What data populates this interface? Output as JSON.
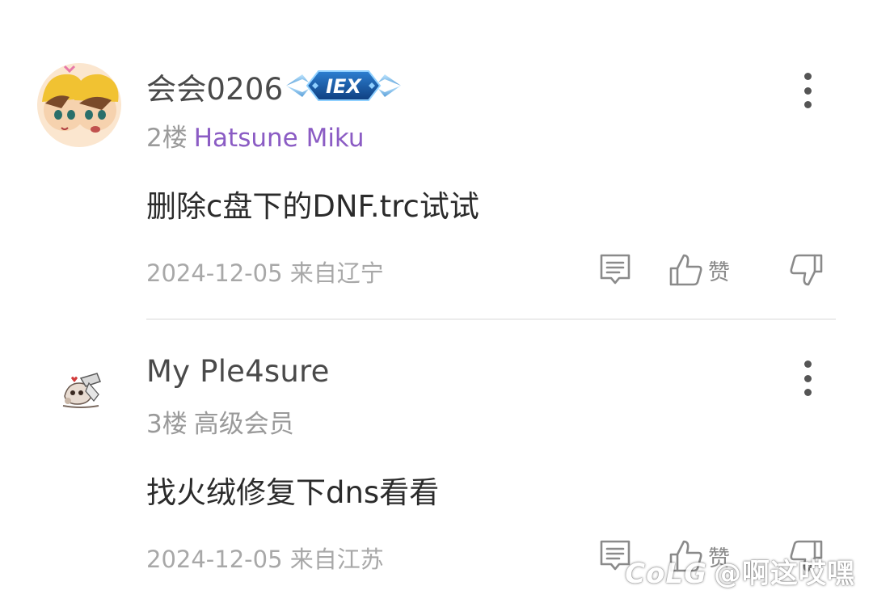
{
  "comments": [
    {
      "username": "会会0206",
      "has_badge": true,
      "badge_text": "IEX",
      "floor": "2楼",
      "user_title": "Hatsune Miku",
      "user_title_color": "#8b5cc4",
      "body": "删除c盘下的DNF.trc试试",
      "date": "2024-12-05",
      "location": "来自辽宁",
      "like_label": "赞"
    },
    {
      "username": "My Ple4sure",
      "has_badge": false,
      "floor": "3楼",
      "user_title": "高级会员",
      "user_title_color": "#9a9a9a",
      "body": "找火绒修复下dns看看",
      "date": "2024-12-05",
      "location": "来自江苏",
      "like_label": "赞"
    }
  ],
  "icons": {
    "more": "more-vertical-icon",
    "reply": "reply-comment-icon",
    "like": "thumbs-up-icon",
    "dislike": "thumbs-down-icon"
  },
  "watermark": {
    "brand": "CoLG",
    "handle": "@啊这哎嘿"
  },
  "colors": {
    "text_primary": "#2b2b2b",
    "text_secondary": "#a8a8a8",
    "title_purple": "#8b5cc4",
    "icon_gray": "#8a8a8a",
    "badge_blue": "#1a5fb4"
  }
}
